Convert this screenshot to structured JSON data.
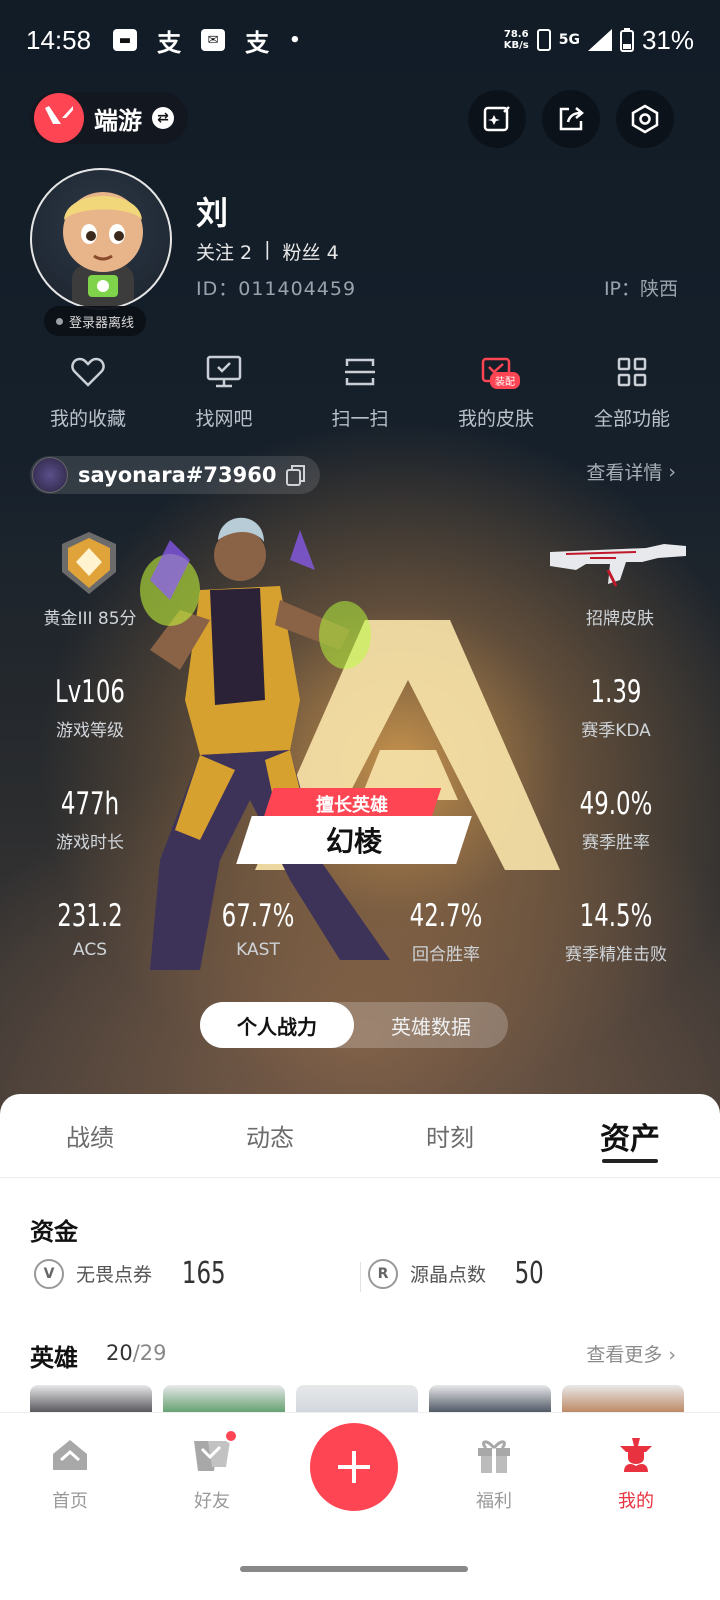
{
  "status_bar": {
    "time": "14:58",
    "net_speed_value": "78.6",
    "net_speed_unit": "KB/s",
    "network": "5G",
    "battery": "31%"
  },
  "header": {
    "game_name": "端游"
  },
  "profile": {
    "username": "刘",
    "following_label": "关注 2",
    "separator": "|",
    "fans_label": "粉丝 4",
    "id": "ID：011404459",
    "ip": "IP：陕西",
    "status": "登录器离线"
  },
  "quick_actions": [
    {
      "label": "我的收藏",
      "icon": "heart-icon"
    },
    {
      "label": "找网吧",
      "icon": "monitor-icon"
    },
    {
      "label": "扫一扫",
      "icon": "scan-icon"
    },
    {
      "label": "我的皮肤",
      "icon": "skin-icon",
      "badge": "装配"
    },
    {
      "label": "全部功能",
      "icon": "grid-icon"
    }
  ],
  "account": {
    "riot_id": "sayonara#73960",
    "details_link": "查看详情"
  },
  "stats": {
    "rank_label": "黄金III 85分",
    "skin_label": "招牌皮肤",
    "level": {
      "value": "Lv106",
      "label": "游戏等级"
    },
    "kda": {
      "value": "1.39",
      "label": "赛季KDA"
    },
    "playtime": {
      "value": "477h",
      "label": "游戏时长"
    },
    "winrate": {
      "value": "49.0%",
      "label": "赛季胜率"
    },
    "acs": {
      "value": "231.2",
      "label": "ACS"
    },
    "kast": {
      "value": "67.7%",
      "label": "KAST"
    },
    "round_win": {
      "value": "42.7%",
      "label": "回合胜率"
    },
    "headshot": {
      "value": "14.5%",
      "label": "赛季精准击败"
    }
  },
  "main_hero": {
    "tag": "擅长英雄",
    "name": "幻棱"
  },
  "toggle": {
    "personal": "个人战力",
    "hero_data": "英雄数据"
  },
  "tabs": [
    "战绩",
    "动态",
    "时刻",
    "资产"
  ],
  "assets": {
    "funds_title": "资金",
    "vp_label": "无畏点券",
    "vp_value": "165",
    "rp_label": "源晶点数",
    "rp_value": "50",
    "heroes_title": "英雄",
    "heroes_count": "20",
    "heroes_total": "/29",
    "more_link": "查看更多"
  },
  "bottom_nav": [
    {
      "label": "首页",
      "icon": "home-icon"
    },
    {
      "label": "好友",
      "icon": "friends-icon"
    },
    {
      "label": "福利",
      "icon": "gift-icon"
    },
    {
      "label": "我的",
      "icon": "me-icon"
    }
  ],
  "colors": {
    "accent": "#fe4553",
    "active_nav": "#e8323f"
  }
}
